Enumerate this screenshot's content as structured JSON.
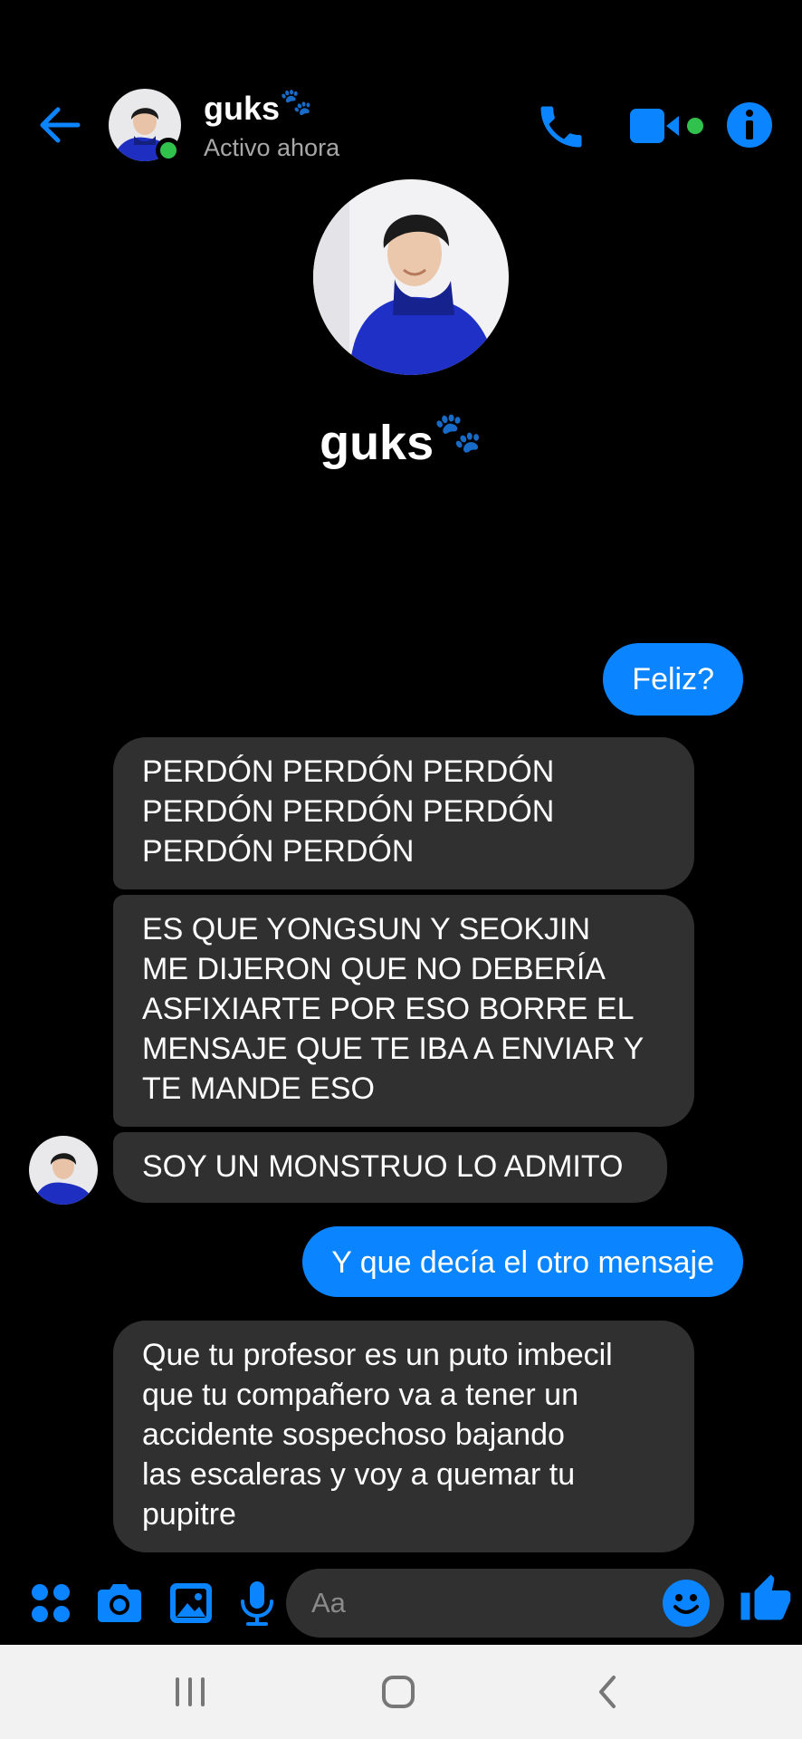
{
  "header": {
    "contact_name": "guks",
    "paw_emoji": "🐾",
    "status": "Activo ahora"
  },
  "profile": {
    "name": "guks",
    "paw_emoji": "🐾"
  },
  "messages": [
    {
      "direction": "outgoing",
      "lines": [
        "Feliz?"
      ]
    },
    {
      "direction": "incoming",
      "lines": [
        "PERDÓN PERDÓN PERDÓN",
        "PERDÓN PERDÓN PERDÓN",
        "PERDÓN PERDÓN"
      ]
    },
    {
      "direction": "incoming",
      "lines": [
        "ES QUE YONGSUN Y SEOKJIN",
        "ME DIJERON QUE NO DEBERÍA",
        "ASFIXIARTE POR ESO BORRE EL",
        "MENSAJE QUE TE IBA A ENVIAR Y",
        "TE MANDE ESO"
      ]
    },
    {
      "direction": "incoming",
      "lines": [
        "SOY UN MONSTRUO LO ADMITO"
      ]
    },
    {
      "direction": "outgoing",
      "lines": [
        "Y que decía el otro mensaje"
      ]
    },
    {
      "direction": "incoming",
      "lines": [
        "Que tu profesor es un puto imbecil",
        "que tu compañero va a tener un",
        "accidente sospechoso bajando",
        "las escaleras y voy a quemar tu",
        "pupitre"
      ]
    }
  ],
  "composer": {
    "placeholder": "Aa"
  },
  "icons": {
    "back": "arrow-left-icon",
    "call": "phone-icon",
    "video": "video-camera-icon",
    "info": "info-icon",
    "apps": "four-dots-icon",
    "camera": "camera-icon",
    "gallery": "image-icon",
    "mic": "microphone-icon",
    "emoji": "smiley-icon",
    "like": "thumbs-up-icon",
    "recents": "recent-apps-icon",
    "home": "home-icon",
    "sys_back": "chevron-left-icon"
  },
  "colors": {
    "accent": "#0b84ff",
    "active": "#31c24d",
    "incoming_bubble": "#303030",
    "background": "#000000"
  }
}
